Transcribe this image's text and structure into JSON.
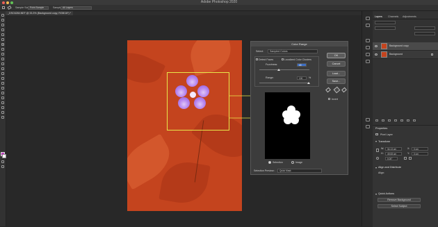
{
  "app": {
    "title": "Adobe Photoshop 2020",
    "colors": {
      "selection_outline": "#e8e84a",
      "canvas_fill": "#c4441e",
      "flower": "#a474e4"
    }
  },
  "options_bar": {
    "sample_size_label": "Sample Size:",
    "sample_size_value": "Point Sample",
    "sample_label": "Sample:",
    "sample_value": "All Layers"
  },
  "document_tab": {
    "label": "_DSC6284.NEF @ 33.3% (Background copy, RGB/16*) *"
  },
  "dialog": {
    "title": "Color Range",
    "select_label": "Select:",
    "select_value": "Sampled Colors",
    "detect_faces": "Detect Faces",
    "localized_clusters": "Localized Color Clusters",
    "fuzziness_label": "Fuzziness:",
    "fuzziness_value": "40",
    "range_label": "Range:",
    "range_value": "100",
    "range_unit": "%",
    "ok": "OK",
    "cancel": "Cancel",
    "load": "Load...",
    "save": "Save...",
    "invert": "Invert",
    "radio_selection": "Selection",
    "radio_image": "Image",
    "preview_label": "Selection Preview:",
    "preview_value": "Quick Mask"
  },
  "panels": {
    "tabs": [
      "Layers",
      "Channels",
      "Adjustments"
    ],
    "layers": [
      {
        "name": "Background copy",
        "selected": true
      },
      {
        "name": "Background",
        "selected": false
      }
    ],
    "properties_title": "Properties",
    "pixel_layer": "Pixel Layer",
    "transform": "Transform",
    "w_label": "W:",
    "w_value": "34.13 cm",
    "h_label": "H:",
    "h_value": "49.08 cm",
    "x_label": "X:",
    "x_value": "0 cm",
    "y_label": "Y:",
    "y_value": "0 cm",
    "angle_value": "0.00°",
    "align_title": "Align and Distribute",
    "align_label": "Align:",
    "quick_actions": "Quick Actions",
    "remove_bg": "Remove Background",
    "select_subject": "Select Subject"
  }
}
